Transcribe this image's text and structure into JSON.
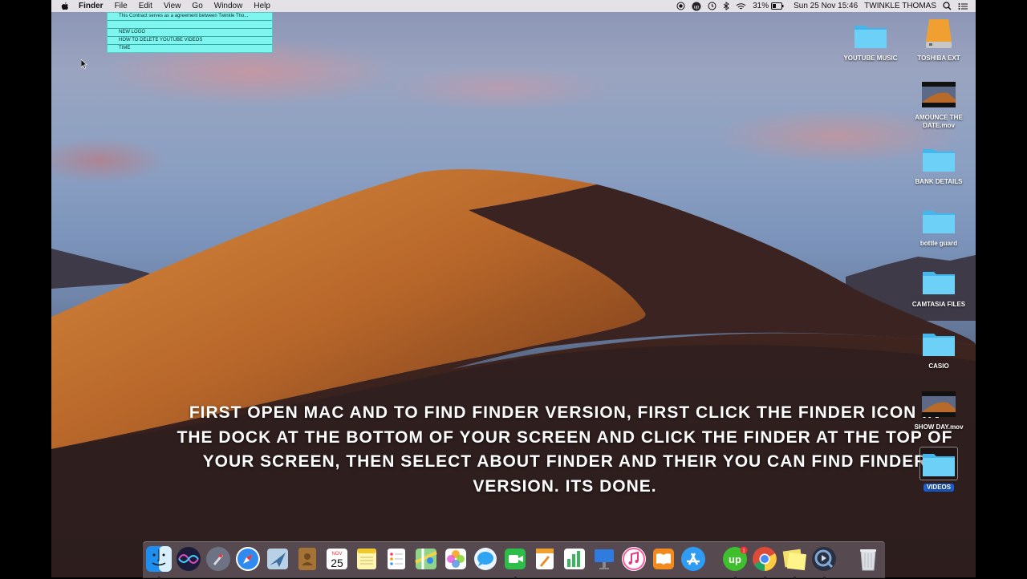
{
  "menubar": {
    "app": "Finder",
    "items": [
      "File",
      "Edit",
      "View",
      "Go",
      "Window",
      "Help"
    ],
    "battery": "31%",
    "datetime": "Sun 25 Nov  15:46",
    "user": "TWINKLE THOMAS"
  },
  "notes_list": {
    "rows": [
      "This Contract serves as a agreement between Twinkle Tho...",
      "",
      "NEW LOGO",
      "HOW TO DELETE YOUTUBE VIDEOS",
      "TIME"
    ]
  },
  "desktop": {
    "icons": [
      {
        "label": "YOUTUBE MUSIC",
        "type": "folder"
      },
      {
        "label": "TOSHIBA EXT",
        "type": "drive"
      },
      {
        "label": "AMOUNCE THE DATE.mov",
        "type": "movie"
      },
      {
        "label": "BANK DETAILS",
        "type": "folder"
      },
      {
        "label": "bottle guard",
        "type": "folder"
      },
      {
        "label": "CAMTASIA FILES",
        "type": "folder"
      },
      {
        "label": "CASIO",
        "type": "folder"
      },
      {
        "label": "SHOW DAY.mov",
        "type": "movie"
      },
      {
        "label": "VIDEOS",
        "type": "folder",
        "selected": true
      }
    ]
  },
  "caption": "FIRST OPEN MAC AND TO FIND FINDER VERSION, FIRST CLICK THE FINDER ICON IN THE DOCK AT THE BOTTOM OF YOUR SCREEN AND CLICK THE FINDER AT THE TOP OF YOUR SCREEN, THEN SELECT ABOUT FINDER AND THEIR YOU CAN FIND FINDER VERSION. ITS DONE.",
  "dock": {
    "calendar_month": "NOV",
    "calendar_day": "25",
    "upwork_badge": "1",
    "apps": [
      "finder-icon",
      "siri-icon",
      "launchpad-icon",
      "safari-icon",
      "mail-icon",
      "contacts-icon",
      "calendar-icon",
      "notes-icon",
      "reminders-icon",
      "maps-icon",
      "photos-icon",
      "messages-icon",
      "facetime-icon",
      "pages-icon",
      "numbers-icon",
      "keynote-icon",
      "itunes-icon",
      "ibooks-icon",
      "app-store-icon",
      "upwork-icon",
      "chrome-icon",
      "stickies-icon",
      "quicktime-icon",
      "trash-icon"
    ]
  }
}
